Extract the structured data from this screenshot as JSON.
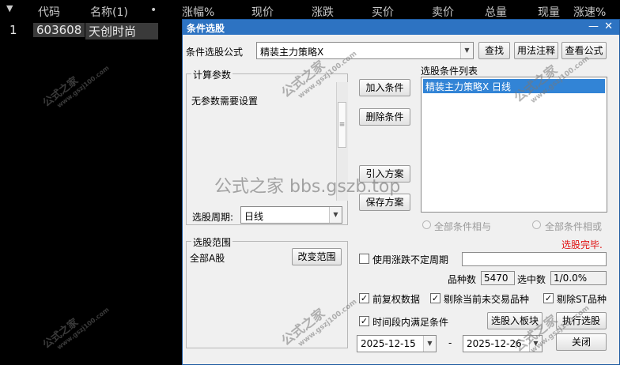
{
  "background_table": {
    "headers": [
      "代码",
      "名称(1)",
      "•",
      "涨幅%",
      "现价",
      "涨跌",
      "买价",
      "卖价",
      "总量",
      "现量",
      "涨速%"
    ],
    "row": {
      "index": "1",
      "code": "603608",
      "name": "天创时尚"
    }
  },
  "watermark": {
    "brand": "公式之家",
    "site": "www.gszj100.com",
    "center": "公式之家 bbs.gszb.top"
  },
  "dialog": {
    "title": "条件选股",
    "formula_label": "条件选股公式",
    "formula_value": "精装主力策略X",
    "find_btn": "查找",
    "usage_btn": "用法注释",
    "view_btn": "查看公式",
    "params_title": "计算参数",
    "params_text": "无参数需要设置",
    "period_label": "选股周期:",
    "period_value": "日线",
    "add_btn": "加入条件",
    "delete_btn": "删除条件",
    "import_btn": "引入方案",
    "save_btn": "保存方案",
    "list_label": "选股条件列表",
    "list_items": [
      "精装主力策略X  日线"
    ],
    "radio_and": "全部条件相与",
    "radio_or": "全部条件相或",
    "status": "选股完毕.",
    "range_title": "选股范围",
    "range_value": "全部A股",
    "change_range_btn": "改变范围",
    "use_range_label": "使用涨跌不定周期",
    "count_label": "品种数",
    "count_value": "5470",
    "selected_label": "选中数",
    "selected_value": "1/0.0%",
    "chk_fq": "前复权数据",
    "chk_exclude": "剔除当前未交易品种",
    "chk_st": "剔除ST品种",
    "chk_time": "时间段内满足条件",
    "to_board_btn": "选股入板块",
    "exec_btn": "执行选股",
    "date_from": "2025-12-15",
    "date_sep": "-",
    "date_to": "2025-12-26",
    "close_btn": "关闭"
  }
}
